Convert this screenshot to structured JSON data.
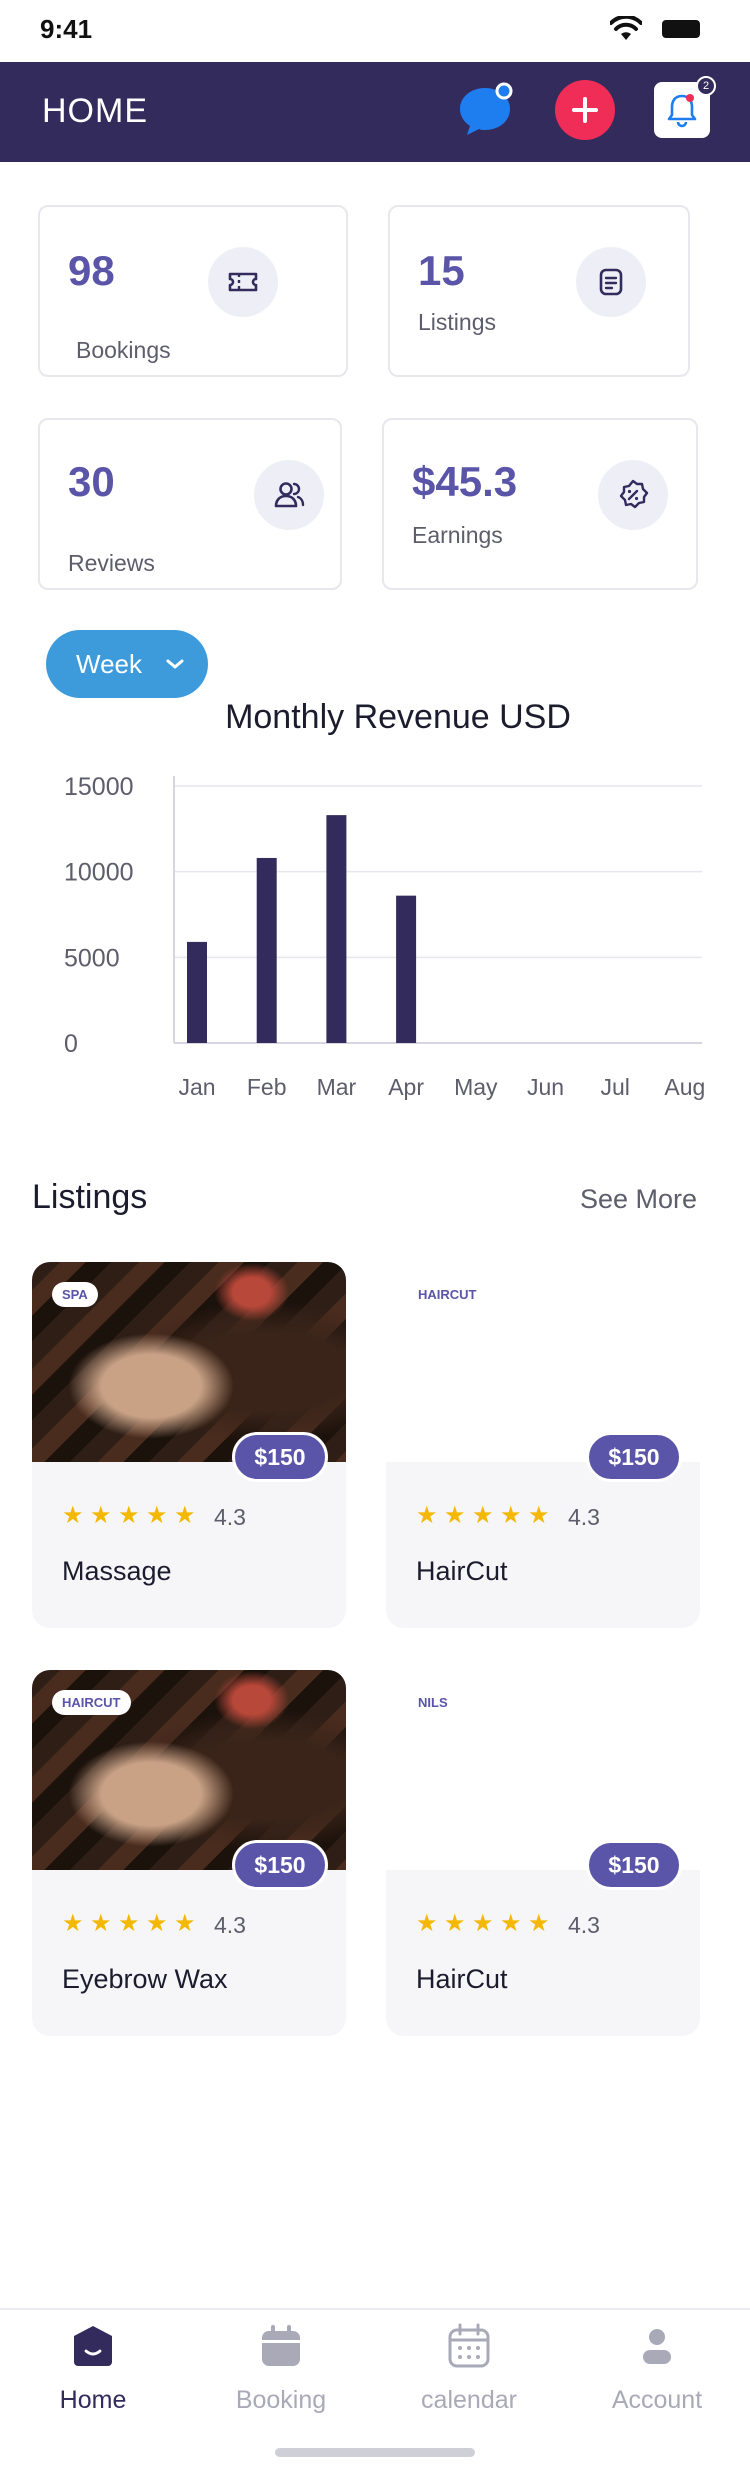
{
  "status_bar": {
    "time": "9:41"
  },
  "header": {
    "title": "HOME",
    "notification_count": "2",
    "colors": {
      "bg": "#342b5d",
      "add": "#ef2d56",
      "chat": "#1e7ef0"
    }
  },
  "stats": [
    {
      "value": "98",
      "label": "Bookings",
      "icon": "ticket-icon"
    },
    {
      "value": "15",
      "label": "Listings",
      "icon": "document-icon"
    },
    {
      "value": "30",
      "label": "Reviews",
      "icon": "users-icon"
    },
    {
      "value": "$45.3",
      "label": "Earnings",
      "icon": "discount-badge-icon"
    }
  ],
  "period_selector": {
    "selected": "Week"
  },
  "chart_data": {
    "type": "bar",
    "title": "Monthly Revenue USD",
    "categories": [
      "Jan",
      "Feb",
      "Mar",
      "Apr",
      "May",
      "Jun",
      "Jul",
      "Aug"
    ],
    "values": [
      5900,
      10800,
      13300,
      8600,
      0,
      0,
      0,
      0
    ],
    "ylim": [
      0,
      15000
    ],
    "yticks": [
      0,
      5000,
      10000,
      15000
    ],
    "grid": true,
    "bar_color": "#342b5d"
  },
  "listings": {
    "title": "Listings",
    "see_more": "See More",
    "items": [
      {
        "tag": "SPA",
        "price": "$150",
        "rating": "4.3",
        "name": "Massage",
        "has_image": true
      },
      {
        "tag": "HAIRCUT",
        "price": "$150",
        "rating": "4.3",
        "name": "HairCut",
        "has_image": false
      },
      {
        "tag": "HAIRCUT",
        "price": "$150",
        "rating": "4.3",
        "name": "Eyebrow Wax",
        "has_image": true
      },
      {
        "tag": "NILS",
        "price": "$150",
        "rating": "4.3",
        "name": "HairCut",
        "has_image": false
      }
    ]
  },
  "bottom_nav": {
    "items": [
      {
        "label": "Home",
        "icon": "home-icon",
        "active": true
      },
      {
        "label": "Booking",
        "icon": "booking-calendar-icon",
        "active": false
      },
      {
        "label": "calendar",
        "icon": "calendar-icon",
        "active": false
      },
      {
        "label": "Account",
        "icon": "account-icon",
        "active": false
      }
    ]
  }
}
